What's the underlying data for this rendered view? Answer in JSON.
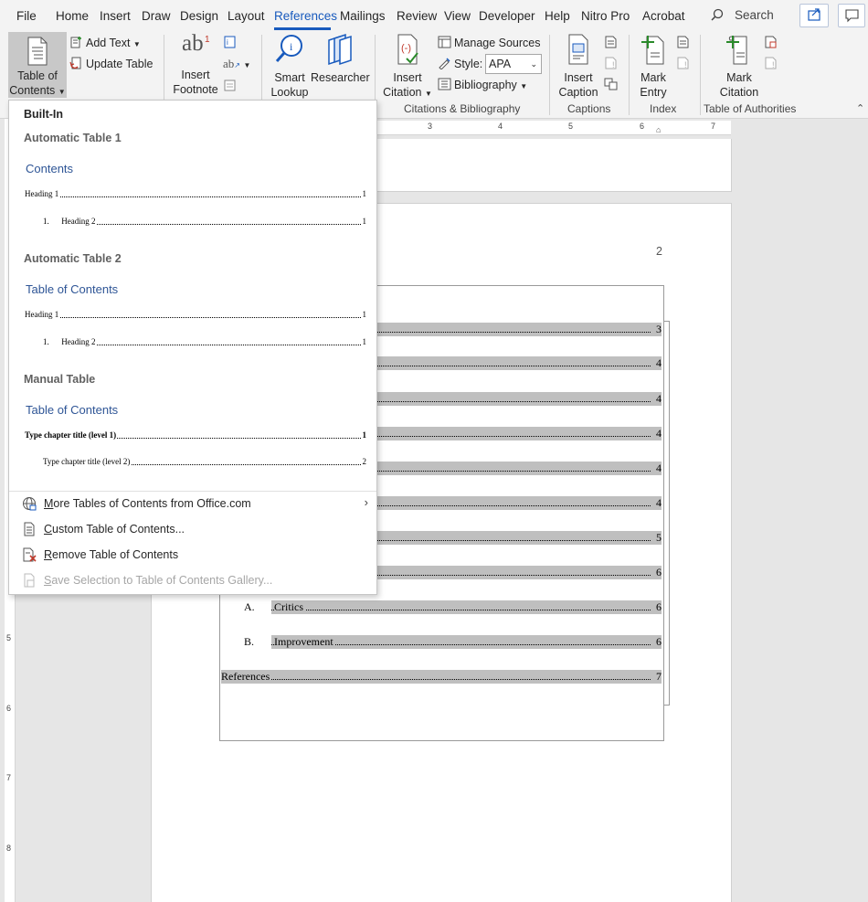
{
  "menubar": {
    "tabs": [
      {
        "label": "File"
      },
      {
        "label": "Home"
      },
      {
        "label": "Insert"
      },
      {
        "label": "Draw"
      },
      {
        "label": "Design"
      },
      {
        "label": "Layout"
      },
      {
        "label": "References"
      },
      {
        "label": "Mailings"
      },
      {
        "label": "Review"
      },
      {
        "label": "View"
      },
      {
        "label": "Developer"
      },
      {
        "label": "Help"
      },
      {
        "label": "Nitro Pro"
      },
      {
        "label": "Acrobat"
      }
    ],
    "active_tab": "References",
    "search_label": "Search",
    "accent_color": "#185abd"
  },
  "ribbon": {
    "toc": {
      "line1": "Table of",
      "line2": "Contents"
    },
    "add_text": "Add Text",
    "update_table": "Update Table",
    "footnote": {
      "line1": "Insert",
      "line2": "Footnote",
      "badge": "1"
    },
    "smart_lookup": {
      "line1": "Smart",
      "line2": "Lookup"
    },
    "researcher": "Researcher",
    "insert_citation": {
      "line1": "Insert",
      "line2": "Citation"
    },
    "manage_sources": "Manage Sources",
    "style_label": "Style:",
    "style_value": "APA",
    "bibliography": "Bibliography",
    "insert_caption": {
      "line1": "Insert",
      "line2": "Caption"
    },
    "mark_entry": {
      "line1": "Mark",
      "line2": "Entry"
    },
    "mark_citation": {
      "line1": "Mark",
      "line2": "Citation"
    },
    "groups": {
      "citations": "Citations & Bibliography",
      "captions": "Captions",
      "index": "Index",
      "authorities": "Table of Authorities"
    }
  },
  "dropdown": {
    "builtin": "Built-In",
    "auto1": {
      "name": "Automatic Table 1",
      "title": "Contents",
      "h1": "Heading 1",
      "h1_page": "1",
      "h2_num": "1.",
      "h2": "Heading 2",
      "h2_page": "1"
    },
    "auto2": {
      "name": "Automatic Table 2",
      "title": "Table of Contents",
      "h1": "Heading 1",
      "h1_page": "1",
      "h2_num": "1.",
      "h2": "Heading 2",
      "h2_page": "1"
    },
    "manual": {
      "name": "Manual Table",
      "title": "Table of Contents",
      "l1": "Type chapter title (level 1)",
      "l1_page": "1",
      "l2": "Type chapter title (level 2)",
      "l2_page": "2"
    },
    "items": {
      "more": "More Tables of Contents from Office.com",
      "custom": "Custom Table of Contents...",
      "remove": "Remove Table of Contents",
      "save": "Save Selection to Table of Contents Gallery..."
    }
  },
  "document": {
    "page_number": "2",
    "toc_pages": [
      "3",
      "4",
      "4",
      "4",
      "4",
      "4",
      "5",
      "6"
    ],
    "entries": [
      {
        "prefix": "A.",
        "label": "Critics",
        "page": "6"
      },
      {
        "prefix": "B.",
        "label": "Improvement",
        "page": "6"
      },
      {
        "prefix": "",
        "label": "References",
        "page": "7"
      }
    ],
    "ruler_numbers": [
      "3",
      "4",
      "5",
      "6",
      "7"
    ],
    "vruler_numbers": [
      "5",
      "6",
      "7",
      "8"
    ]
  }
}
